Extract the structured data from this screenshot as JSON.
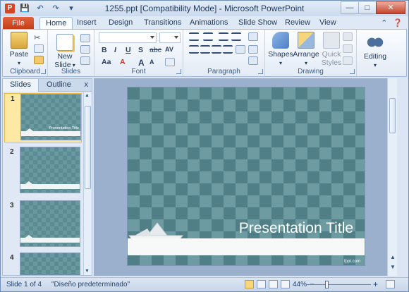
{
  "window": {
    "title": "1255.ppt [Compatibility Mode]  -  Microsoft PowerPoint"
  },
  "qat": {
    "save_icon": "save-icon",
    "undo_icon": "undo-icon",
    "redo_icon": "redo-icon"
  },
  "tabs": {
    "file": "File",
    "items": [
      "Home",
      "Insert",
      "Design",
      "Transitions",
      "Animations",
      "Slide Show",
      "Review",
      "View"
    ]
  },
  "ribbon": {
    "clipboard": {
      "label": "Clipboard",
      "paste": "Paste"
    },
    "slides": {
      "label": "Slides",
      "new_slide_line1": "New",
      "new_slide_line2": "Slide"
    },
    "font": {
      "label": "Font",
      "bold": "B",
      "italic": "I",
      "underline": "U",
      "shadow": "S",
      "strike": "abc",
      "spacing": "AV",
      "case": "Aa",
      "color": "A",
      "grow": "A",
      "shrink": "A"
    },
    "paragraph": {
      "label": "Paragraph"
    },
    "drawing": {
      "label": "Drawing",
      "shapes": "Shapes",
      "arrange": "Arrange",
      "quick_styles_line1": "Quick",
      "quick_styles_line2": "Styles"
    },
    "editing": {
      "label": "Editing"
    }
  },
  "left_pane": {
    "tab_slides": "Slides",
    "tab_outline": "Outline",
    "close": "x",
    "slides": [
      {
        "num": "1",
        "title": "Presentation Title"
      },
      {
        "num": "2",
        "title": ""
      },
      {
        "num": "3",
        "title": ""
      },
      {
        "num": "4",
        "title": ""
      }
    ]
  },
  "slide": {
    "title": "Presentation Title",
    "footer": "fppt.com"
  },
  "status": {
    "slide_info": "Slide 1 of 4",
    "theme": "\"Diseño predeterminado\"",
    "zoom": "44%",
    "zoom_minus": "−",
    "zoom_plus": "+"
  },
  "colors": {
    "file_tab": "#d24726",
    "slide_bg": "#517f87",
    "selected_thumb": "#fde9a3"
  }
}
